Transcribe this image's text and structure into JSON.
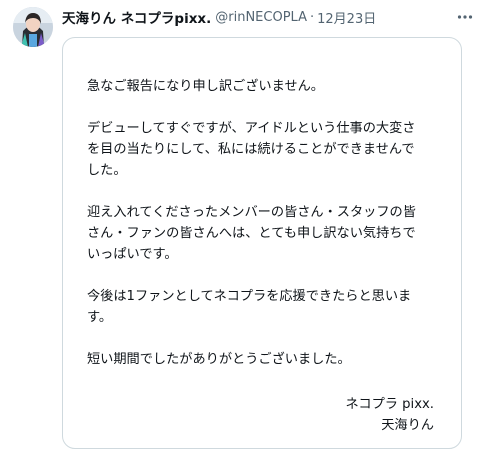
{
  "tweet": {
    "display_name": "天海りん ネコプラpixx.",
    "handle": "@rinNECOPLA",
    "separator": "·",
    "timestamp": "12月23日",
    "more_icon": "more-dots-icon"
  },
  "letter": {
    "paragraphs": [
      "急なご報告になり申し訳ございません。",
      "デビューしてすぐですが、アイドルという仕事の大変さ\nを目の当たりにして、私には続けることができませんで\nした。",
      "迎え入れてくださったメンバーの皆さん・スタッフの皆\nさん・ファンの皆さんへは、とても申し訳ない気持ちで\nいっぱいです。",
      "今後は1ファンとしてネコプラを応援できたらと思いま\nす。",
      "短い期間でしたがありがとうございました。"
    ],
    "signature_group": "ネコプラ pixx.",
    "signature_name": "天海りん"
  },
  "colors": {
    "text": "#0f1419",
    "muted": "#536471",
    "border": "#cfd9de"
  }
}
